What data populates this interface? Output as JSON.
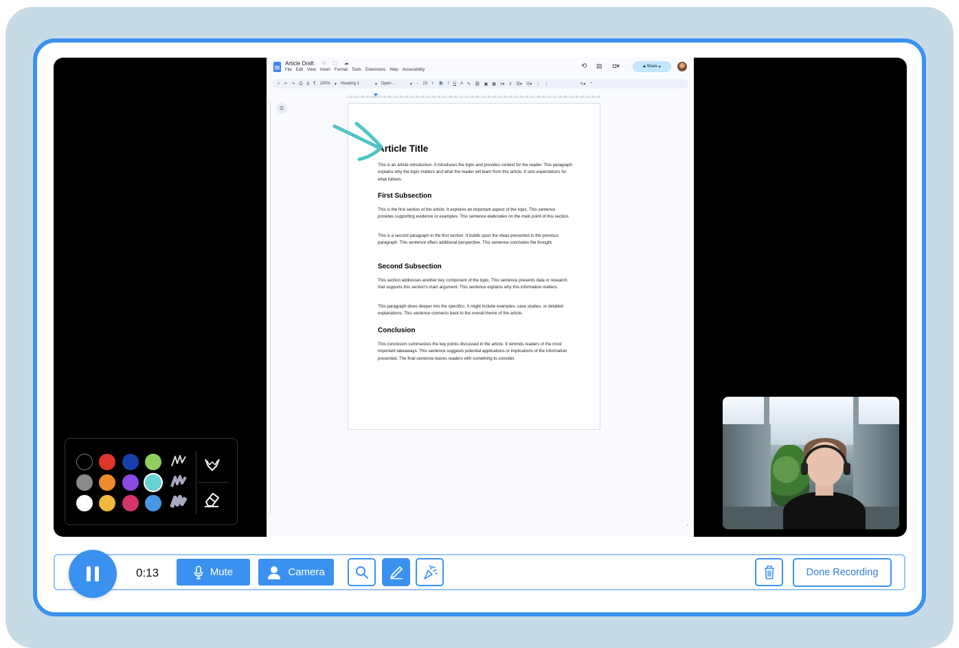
{
  "document": {
    "title": "Article Draft",
    "menu": [
      "File",
      "Edit",
      "View",
      "Insert",
      "Format",
      "Tools",
      "Extensions",
      "Help",
      "Accessibility"
    ],
    "share_label": "Share",
    "toolbar": {
      "zoom": "100%",
      "style": "Heading 1",
      "font": "Open ...",
      "font_size": "23"
    },
    "content": {
      "title": "Article Title",
      "intro": "This is an article introduction. It introduces the topic and provides context for the reader. This paragraph explains why the topic matters and what the reader will learn from this article. It sets expectations for what follows.",
      "section1_heading": "First Subsection",
      "section1_p1": "This is the first section of the article. It explores an important aspect of the topic. This sentence provides supporting evidence or examples. This sentence elaborates on the main point of this section.",
      "section1_p2": "This is a second paragraph in the first section. It builds upon the ideas presented in the previous paragraph. This sentence offers additional perspective. This sentence concludes the thought.",
      "section2_heading": "Second Subsection",
      "section2_p1": "This section addresses another key component of the topic. This sentence presents data or research that supports this section's main argument. This sentence explains why this information matters.",
      "section2_p2": "This paragraph dives deeper into the specifics. It might include examples, case studies, or detailed explanations. This sentence connects back to the overall theme of the article.",
      "conclusion_heading": "Conclusion",
      "conclusion_p": "This conclusion summarizes the key points discussed in the article. It reminds readers of the most important takeaways. This sentence suggests potential applications or implications of the information presented. The final sentence leaves readers with something to consider."
    }
  },
  "palette": {
    "colors": [
      "#000000",
      "#e0352b",
      "#1a3fa8",
      "#8fcf62",
      "#8a8a8a",
      "#ef8a2e",
      "#8b49e6",
      "#67d3d3",
      "#ffffff",
      "#f1b83c",
      "#d6336c",
      "#4a96e6"
    ],
    "annotation_color": "#4fc3c6",
    "icons": [
      "pen-thin-icon",
      "pen-medium-icon",
      "pen-thick-icon",
      "highlighter-icon",
      "eraser-icon"
    ]
  },
  "controls": {
    "timer": "0:13",
    "mute_label": "Mute",
    "camera_label": "Camera",
    "done_label": "Done Recording"
  },
  "colors": {
    "accent": "#3b91ef",
    "background": "#c7dbe6"
  }
}
